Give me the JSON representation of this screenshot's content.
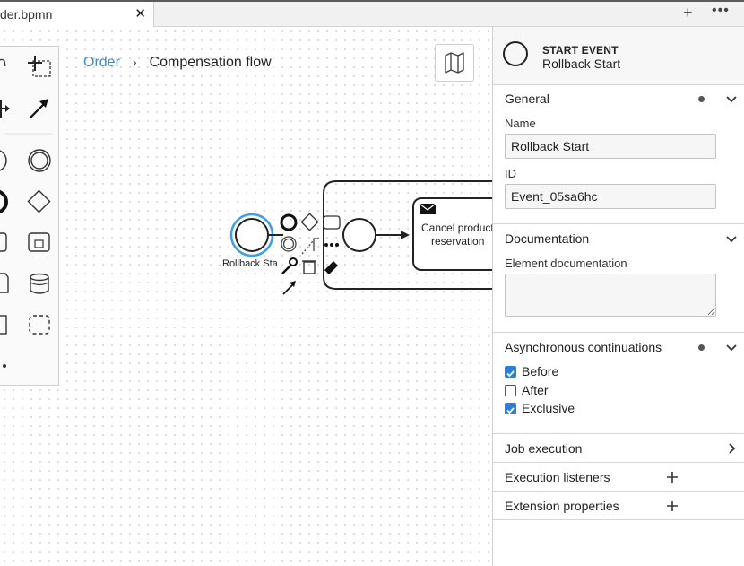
{
  "tabs": [
    {
      "label": "der.bpmn",
      "active": true
    }
  ],
  "tabbar": {
    "close_glyph": "✕",
    "add_glyph": "+",
    "more_glyph": "•••"
  },
  "breadcrumb": {
    "root": "Order",
    "separator": "›",
    "current": "Compensation flow"
  },
  "diagram": {
    "start_event_label": "Rollback Sta",
    "task_label_line1": "Cancel product",
    "task_label_line2": "reservation"
  },
  "panel": {
    "element_type": "START EVENT",
    "element_name": "Rollback Start",
    "groups": {
      "general": {
        "title": "General",
        "name_label": "Name",
        "name_value": "Rollback Start",
        "id_label": "ID",
        "id_value": "Event_05sa6hc"
      },
      "documentation": {
        "title": "Documentation",
        "doc_label": "Element documentation"
      },
      "async": {
        "title": "Asynchronous continuations",
        "options": [
          {
            "label": "Before",
            "checked": true
          },
          {
            "label": "After",
            "checked": false
          },
          {
            "label": "Exclusive",
            "checked": true
          }
        ]
      },
      "job_execution": {
        "title": "Job execution"
      },
      "execution_listeners": {
        "title": "Execution listeners"
      },
      "extension_properties": {
        "title": "Extension properties"
      }
    }
  },
  "colors": {
    "accent": "#2b7fd7",
    "link": "#3a8bd6",
    "selection": "#3a9ee8"
  }
}
